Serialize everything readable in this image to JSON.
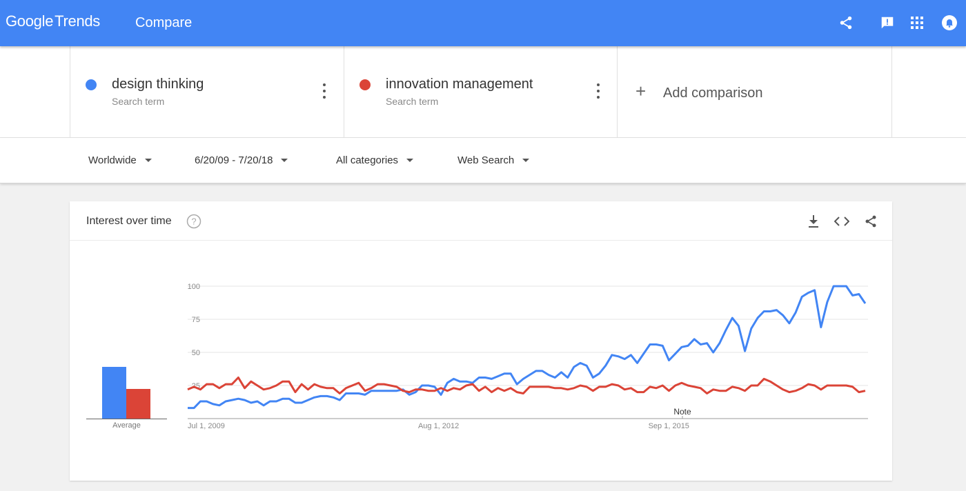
{
  "header": {
    "logo_google": "Google",
    "logo_trends": "Trends",
    "page_title": "Compare",
    "icons": [
      "share-icon",
      "feedback-icon",
      "apps-icon",
      "notifications-icon"
    ]
  },
  "terms": [
    {
      "name": "design thinking",
      "sub": "Search term",
      "color": "#4285f4"
    },
    {
      "name": "innovation management",
      "sub": "Search term",
      "color": "#db4437"
    }
  ],
  "add_comparison": {
    "plus": "+",
    "label": "Add comparison"
  },
  "filters": {
    "region": "Worldwide",
    "date_range": "6/20/09 - 7/20/18",
    "category": "All categories",
    "search_type": "Web Search"
  },
  "card": {
    "title": "Interest over time",
    "icons": [
      "help-icon",
      "download-icon",
      "embed-icon",
      "share-icon"
    ]
  },
  "average": {
    "label": "Average",
    "values": [
      40,
      23
    ]
  },
  "note": "Note",
  "colors": {
    "accent": "#4285f4",
    "series1": "#4285f4",
    "series2": "#db4437"
  },
  "chart_data": {
    "type": "line",
    "x_start": "2009-07-01",
    "x_end": "2018-07-01",
    "x_tick_labels": [
      "Jul 1, 2009",
      "Aug 1, 2012",
      "Sep 1, 2015"
    ],
    "y_ticks": [
      25,
      50,
      75,
      100
    ],
    "ylim": [
      0,
      100
    ],
    "grid": true,
    "series": [
      {
        "name": "design thinking",
        "color": "#4285f4",
        "values": [
          8,
          8,
          13,
          13,
          11,
          10,
          13,
          14,
          15,
          14,
          12,
          13,
          10,
          13,
          13,
          15,
          15,
          12,
          12,
          14,
          16,
          17,
          17,
          16,
          14,
          19,
          19,
          19,
          18,
          21,
          21,
          21,
          21,
          21,
          22,
          18,
          20,
          25,
          25,
          24,
          18,
          27,
          30,
          28,
          28,
          27,
          31,
          31,
          30,
          32,
          34,
          34,
          26,
          30,
          33,
          36,
          36,
          33,
          31,
          35,
          31,
          39,
          42,
          40,
          31,
          34,
          40,
          48,
          47,
          45,
          48,
          42,
          49,
          56,
          56,
          55,
          44,
          49,
          54,
          55,
          60,
          56,
          57,
          50,
          57,
          67,
          76,
          70,
          51,
          68,
          76,
          81,
          81,
          82,
          78,
          72,
          80,
          92,
          95,
          97,
          69,
          88,
          100,
          100,
          100,
          93,
          94,
          87
        ]
      },
      {
        "name": "innovation management",
        "color": "#db4437",
        "values": [
          22,
          24,
          22,
          26,
          26,
          23,
          26,
          26,
          31,
          23,
          28,
          25,
          22,
          23,
          25,
          28,
          28,
          20,
          26,
          22,
          26,
          24,
          23,
          23,
          19,
          23,
          25,
          27,
          21,
          23,
          26,
          26,
          25,
          24,
          21,
          20,
          22,
          22,
          21,
          21,
          23,
          21,
          23,
          22,
          25,
          26,
          21,
          24,
          20,
          23,
          21,
          23,
          20,
          19,
          24,
          24,
          24,
          24,
          23,
          23,
          22,
          23,
          25,
          24,
          21,
          24,
          24,
          26,
          25,
          22,
          23,
          20,
          20,
          24,
          23,
          25,
          21,
          25,
          27,
          25,
          24,
          23,
          19,
          22,
          21,
          21,
          24,
          23,
          21,
          25,
          25,
          30,
          28,
          25,
          22,
          20,
          21,
          23,
          26,
          25,
          22,
          25,
          25,
          25,
          25,
          24,
          20,
          21
        ]
      }
    ]
  }
}
